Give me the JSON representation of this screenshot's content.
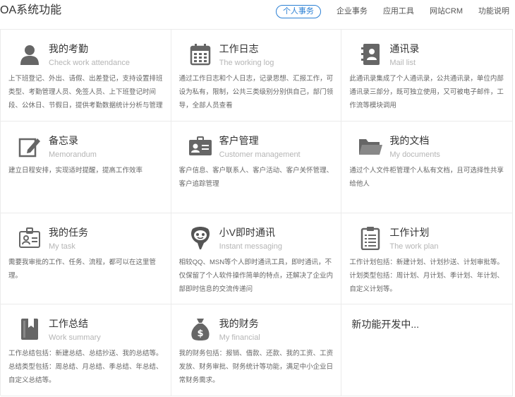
{
  "header": {
    "title": "OA系统功能",
    "tabs": [
      {
        "label": "个人事务",
        "active": true
      },
      {
        "label": "企业事务",
        "active": false
      },
      {
        "label": "应用工具",
        "active": false
      },
      {
        "label": "网站CRM",
        "active": false
      },
      {
        "label": "功能说明",
        "active": false
      }
    ]
  },
  "colors": {
    "accent": "#2a7fd4",
    "icon": "#666666",
    "border": "#ebebeb"
  },
  "cards": [
    {
      "icon": "person-icon",
      "title": "我的考勤",
      "subtitle": "Check work attendance",
      "desc": "上下班登记、外出、请假、出差登记，支持设置排班类型、考勤管理人员、免签人员、上下班登记时间段、公休日、节假日，提供考勤数据统计分析与管理"
    },
    {
      "icon": "calendar-icon",
      "title": "工作日志",
      "subtitle": "The working log",
      "desc": "通过工作日志和个人日志，记录思想、汇报工作，可设为私有，限制，公共三类级别分别供自己，部门领导，全部人员查看"
    },
    {
      "icon": "address-book-icon",
      "title": "通讯录",
      "subtitle": "Mail list",
      "desc": "此通讯录集成了个人通讯录，公共通讯录，单位内部通讯录三部分，既可独立使用，又可被电子邮件，工作流等模块调用"
    },
    {
      "icon": "memo-edit-icon",
      "title": "备忘录",
      "subtitle": "Memorandum",
      "desc": "建立日程安排，实现适时提醒，提高工作效率"
    },
    {
      "icon": "id-card-icon",
      "title": "客户管理",
      "subtitle": "Customer management",
      "desc": "客户信息、客户联系人、客户活动、客户关怀管理、客户追踪管理"
    },
    {
      "icon": "folder-icon",
      "title": "我的文档",
      "subtitle": "My documents",
      "desc": "通过个人文件柜管理个人私有文档，且可选择性共享给他人"
    },
    {
      "icon": "badge-icon",
      "title": "我的任务",
      "subtitle": "My task",
      "desc": "需要我审批的工作、任务、流程，都可以在这里管理。"
    },
    {
      "icon": "mascot-icon",
      "title": "小V即时通讯",
      "subtitle": "Instant messaging",
      "desc": "相较QQ、MSN等个人即时通讯工具，即时通讯，不仅保留了个人软件操作简单的特点，还解决了企业内部即时信息的交流传递问"
    },
    {
      "icon": "clipboard-icon",
      "title": "工作计划",
      "subtitle": "The work plan",
      "desc": "工作计划包括：新建计划、计划抄送、计划审批等。计划类型包括：周计划、月计划、季计划、年计划、自定义计划等。"
    },
    {
      "icon": "bookmark-book-icon",
      "title": "工作总结",
      "subtitle": "Work summary",
      "desc": "工作总结包括：新建总结、总结抄送、我的总结等。总结类型包括：周总结、月总结、季总结、年总结、自定义总结等。"
    },
    {
      "icon": "money-bag-icon",
      "title": "我的财务",
      "subtitle": "My financial",
      "desc": "我的财务包括：报销、借款、还款、我的工资、工资发放、财务审批、财务统计等功能，满足中小企业日常财务需求。"
    },
    {
      "icon": "",
      "title": "新功能开发中...",
      "subtitle": "",
      "desc": ""
    }
  ]
}
